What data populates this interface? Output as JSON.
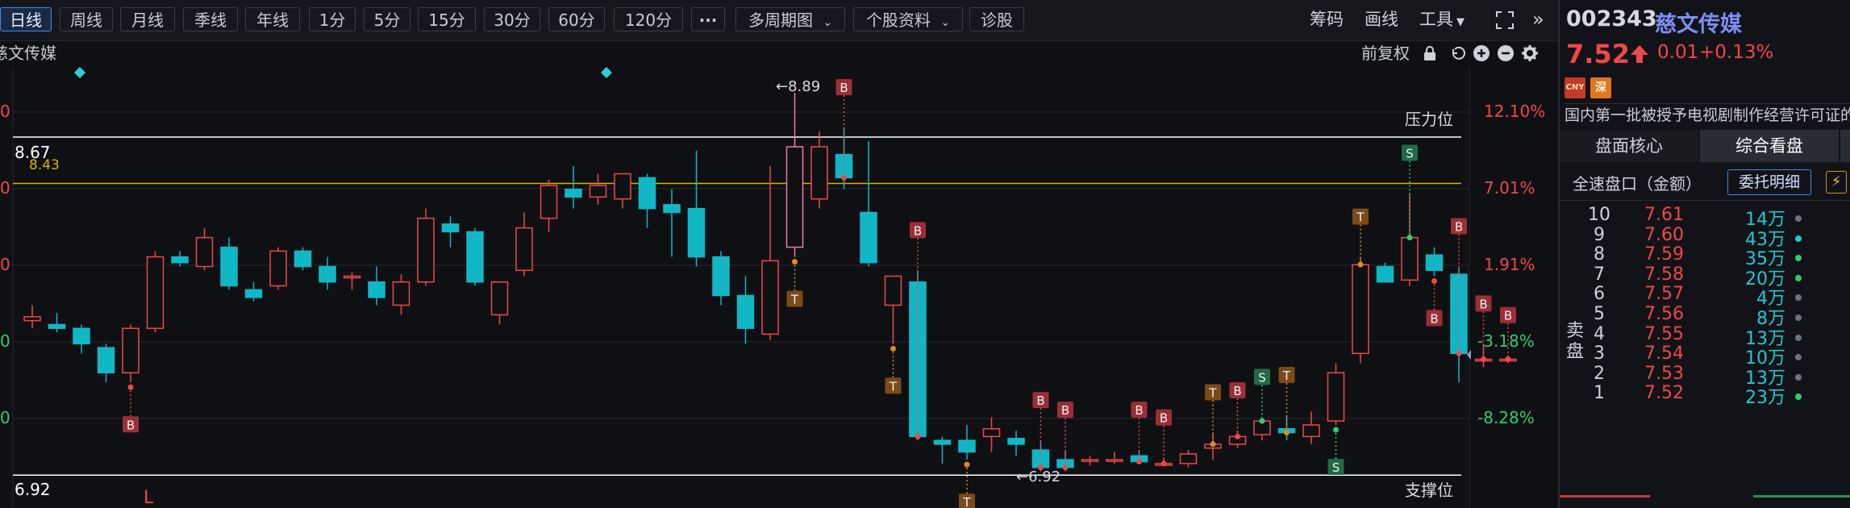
{
  "toolbar": {
    "periods": [
      "日线",
      "周线",
      "月线",
      "季线",
      "年线",
      "1分",
      "5分",
      "15分",
      "30分",
      "60分",
      "120分"
    ],
    "more": "···",
    "multi_period": "多周期图",
    "stock_info": "个股资料",
    "diagnose": "诊股",
    "chips": "筹码",
    "draw": "画线",
    "tools": "工具"
  },
  "subbar": {
    "stock_caption": "慈文传媒",
    "adjust": "前复权"
  },
  "chart_data": {
    "type": "candlestick",
    "ylim": [
      6.8,
      9.0
    ],
    "y_ticks_left": [
      "0",
      "0",
      "0",
      "0",
      "0"
    ],
    "y_ticks_right": [
      "12.10%",
      "7.01%",
      "1.91%",
      "-3.18%",
      "-8.28%"
    ],
    "pressure_label": "压力位",
    "support_label": "支撑位",
    "pressure_price": 8.67,
    "support_price": 6.92,
    "pressure_text": "8.67",
    "support_text": "6.92",
    "yellow_price": 8.43,
    "yellow_text": "8.43",
    "high_annot": "←8.89",
    "low_annot": "←6.92",
    "corner_label": "L",
    "last_price": 7.52,
    "candles": [
      [
        7.72,
        7.8,
        7.68,
        7.74
      ],
      [
        7.7,
        7.76,
        7.66,
        7.68
      ],
      [
        7.68,
        7.7,
        7.55,
        7.6
      ],
      [
        7.58,
        7.6,
        7.4,
        7.45
      ],
      [
        7.45,
        7.7,
        7.4,
        7.68
      ],
      [
        7.68,
        8.08,
        7.66,
        8.05
      ],
      [
        8.05,
        8.08,
        8.0,
        8.02
      ],
      [
        8.0,
        8.2,
        7.98,
        8.15
      ],
      [
        8.1,
        8.15,
        7.88,
        7.9
      ],
      [
        7.88,
        7.92,
        7.82,
        7.84
      ],
      [
        7.9,
        8.1,
        7.88,
        8.08
      ],
      [
        8.08,
        8.1,
        7.98,
        8.0
      ],
      [
        8.0,
        8.05,
        7.88,
        7.92
      ],
      [
        7.95,
        7.97,
        7.88,
        7.95
      ],
      [
        7.92,
        8.0,
        7.8,
        7.84
      ],
      [
        7.8,
        7.96,
        7.75,
        7.92
      ],
      [
        7.92,
        8.3,
        7.9,
        8.25
      ],
      [
        8.22,
        8.26,
        8.1,
        8.18
      ],
      [
        8.18,
        8.2,
        7.9,
        7.92
      ],
      [
        7.75,
        7.92,
        7.7,
        7.92
      ],
      [
        7.98,
        8.28,
        7.95,
        8.2
      ],
      [
        8.25,
        8.45,
        8.18,
        8.42
      ],
      [
        8.4,
        8.52,
        8.3,
        8.36
      ],
      [
        8.36,
        8.48,
        8.32,
        8.42
      ],
      [
        8.35,
        8.45,
        8.3,
        8.48
      ],
      [
        8.46,
        8.48,
        8.2,
        8.3
      ],
      [
        8.32,
        8.4,
        8.05,
        8.28
      ],
      [
        8.3,
        8.6,
        8.0,
        8.05
      ],
      [
        8.05,
        8.08,
        7.8,
        7.85
      ],
      [
        7.85,
        7.95,
        7.6,
        7.68
      ],
      [
        7.65,
        8.52,
        7.62,
        8.03
      ],
      [
        8.1,
        8.9,
        8.05,
        8.62
      ],
      [
        8.35,
        8.7,
        8.3,
        8.62
      ],
      [
        8.58,
        8.72,
        8.4,
        8.46
      ],
      [
        8.28,
        8.65,
        8.0,
        8.02
      ],
      [
        7.8,
        7.95,
        7.6,
        7.95
      ],
      [
        7.92,
        7.98,
        7.1,
        7.12
      ],
      [
        7.1,
        7.12,
        6.98,
        7.08
      ],
      [
        7.1,
        7.18,
        7.0,
        7.04
      ],
      [
        7.12,
        7.22,
        7.04,
        7.16
      ],
      [
        7.11,
        7.15,
        7.02,
        7.08
      ],
      [
        7.05,
        7.1,
        6.94,
        6.96
      ],
      [
        7.0,
        7.05,
        6.94,
        6.96
      ],
      [
        7.0,
        7.02,
        6.97,
        7.0
      ],
      [
        7.0,
        7.04,
        6.98,
        7.0
      ],
      [
        7.02,
        7.05,
        6.98,
        6.99
      ],
      [
        6.98,
        7.01,
        6.97,
        6.98
      ],
      [
        6.98,
        7.05,
        6.96,
        7.03
      ],
      [
        7.06,
        7.14,
        7.0,
        7.08
      ],
      [
        7.08,
        7.15,
        7.06,
        7.12
      ],
      [
        7.13,
        7.22,
        7.1,
        7.2
      ],
      [
        7.16,
        7.23,
        7.1,
        7.14
      ],
      [
        7.12,
        7.25,
        7.08,
        7.18
      ],
      [
        7.2,
        7.5,
        7.18,
        7.45
      ],
      [
        7.55,
        8.05,
        7.5,
        8.01
      ],
      [
        8.0,
        8.02,
        7.93,
        7.92
      ],
      [
        7.93,
        8.38,
        7.9,
        8.15
      ],
      [
        8.06,
        8.1,
        7.95,
        7.98
      ],
      [
        7.96,
        8.0,
        7.4,
        7.55
      ],
      [
        7.52,
        7.6,
        7.48,
        7.52
      ],
      [
        7.52,
        7.54,
        7.5,
        7.52
      ]
    ],
    "signals": [
      {
        "i": 4,
        "type": "B",
        "where": "below"
      },
      {
        "i": 31,
        "type": "T",
        "where": "below"
      },
      {
        "i": 33,
        "type": "B",
        "where": "above"
      },
      {
        "i": 35,
        "type": "T",
        "where": "below"
      },
      {
        "i": 36,
        "type": "B",
        "where": "above"
      },
      {
        "i": 38,
        "type": "T",
        "where": "below"
      },
      {
        "i": 41,
        "type": "B",
        "where": "above"
      },
      {
        "i": 42,
        "type": "B",
        "where": "above"
      },
      {
        "i": 45,
        "type": "B",
        "where": "above"
      },
      {
        "i": 46,
        "type": "B",
        "where": "above"
      },
      {
        "i": 48,
        "type": "T",
        "where": "above"
      },
      {
        "i": 49,
        "type": "B",
        "where": "above"
      },
      {
        "i": 50,
        "type": "S",
        "where": "above"
      },
      {
        "i": 51,
        "type": "T",
        "where": "above"
      },
      {
        "i": 53,
        "type": "S",
        "where": "below"
      },
      {
        "i": 54,
        "type": "T",
        "where": "above"
      },
      {
        "i": 56,
        "type": "S",
        "where": "above"
      },
      {
        "i": 58,
        "type": "B",
        "where": "above"
      },
      {
        "i": 57,
        "type": "B",
        "where": "below"
      },
      {
        "i": 59,
        "type": "B",
        "where": "above"
      },
      {
        "i": 60,
        "type": "B",
        "where": "above"
      }
    ]
  },
  "quote": {
    "code": "002343",
    "name": "慈文传媒",
    "price": "7.52",
    "change": "0.01",
    "pct": "+0.13%",
    "badge_cny": "CNY",
    "badge_sz": "深",
    "description": "国内第一批被授予电视剧制作经营许可证的民营企业"
  },
  "tabs": {
    "core": "盘面核心",
    "overview": "综合看盘",
    "full_depth": "全速盘口（金额）",
    "order_detail": "委托明细",
    "flash": "⚡"
  },
  "asks": {
    "sell_label": "卖盘",
    "rows": [
      {
        "level": "10",
        "price": "7.61",
        "vol": "14万",
        "dot": "#6f737c"
      },
      {
        "level": "9",
        "price": "7.60",
        "vol": "43万",
        "dot": "#22c7d3"
      },
      {
        "level": "8",
        "price": "7.59",
        "vol": "35万",
        "dot": "#2ecc71"
      },
      {
        "level": "7",
        "price": "7.58",
        "vol": "20万",
        "dot": "#2ecc71"
      },
      {
        "level": "6",
        "price": "7.57",
        "vol": "4万",
        "dot": "#6f737c"
      },
      {
        "level": "5",
        "price": "7.56",
        "vol": "8万",
        "dot": "#6f737c"
      },
      {
        "level": "4",
        "price": "7.55",
        "vol": "13万",
        "dot": "#6f737c"
      },
      {
        "level": "3",
        "price": "7.54",
        "vol": "10万",
        "dot": "#6f737c"
      },
      {
        "level": "2",
        "price": "7.53",
        "vol": "13万",
        "dot": "#6f737c"
      },
      {
        "level": "1",
        "price": "7.52",
        "vol": "23万",
        "dot": "#2ecc71"
      }
    ]
  },
  "colors": {
    "up": "#f04848",
    "down": "#12b7c6",
    "pressure": "#ffffff",
    "yellow": "#d9b400",
    "pct_up": "#f04848",
    "pct_down": "#2ecc71"
  }
}
